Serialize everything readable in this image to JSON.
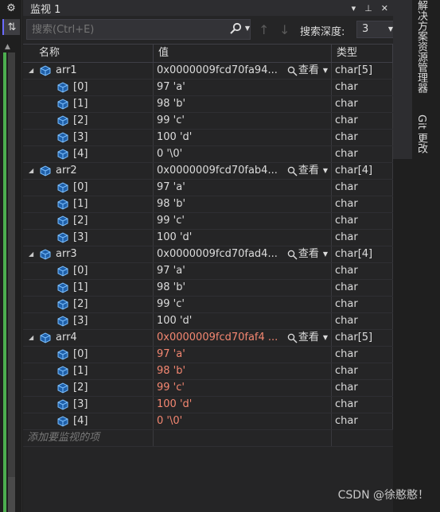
{
  "toolbar_left": {
    "gear_glyph": "⚙",
    "pin_glyph": "⇅"
  },
  "window": {
    "title": "监视 1",
    "dropdown_glyph": "▾",
    "pin_glyph": "⊥",
    "close_glyph": "✕"
  },
  "search": {
    "placeholder": "搜索(Ctrl+E)",
    "depth_label": "搜索深度:",
    "depth_value": "3"
  },
  "columns": {
    "name": "名称",
    "value": "值",
    "type": "类型"
  },
  "view_label": "查看",
  "rows": [
    {
      "level": 0,
      "name": "arr1",
      "value": "0x0000009fcd70fa94...",
      "type": "char[5]",
      "has_view": true,
      "changed": false
    },
    {
      "level": 1,
      "name": "[0]",
      "value": "97 'a'",
      "type": "char",
      "changed": false
    },
    {
      "level": 1,
      "name": "[1]",
      "value": "98 'b'",
      "type": "char",
      "changed": false
    },
    {
      "level": 1,
      "name": "[2]",
      "value": "99 'c'",
      "type": "char",
      "changed": false
    },
    {
      "level": 1,
      "name": "[3]",
      "value": "100 'd'",
      "type": "char",
      "changed": false
    },
    {
      "level": 1,
      "name": "[4]",
      "value": "0 '\\0'",
      "type": "char",
      "changed": false
    },
    {
      "level": 0,
      "name": "arr2",
      "value": "0x0000009fcd70fab4...",
      "type": "char[4]",
      "has_view": true,
      "changed": false
    },
    {
      "level": 1,
      "name": "[0]",
      "value": "97 'a'",
      "type": "char",
      "changed": false
    },
    {
      "level": 1,
      "name": "[1]",
      "value": "98 'b'",
      "type": "char",
      "changed": false
    },
    {
      "level": 1,
      "name": "[2]",
      "value": "99 'c'",
      "type": "char",
      "changed": false
    },
    {
      "level": 1,
      "name": "[3]",
      "value": "100 'd'",
      "type": "char",
      "changed": false
    },
    {
      "level": 0,
      "name": "arr3",
      "value": "0x0000009fcd70fad4...",
      "type": "char[4]",
      "has_view": true,
      "changed": false
    },
    {
      "level": 1,
      "name": "[0]",
      "value": "97 'a'",
      "type": "char",
      "changed": false
    },
    {
      "level": 1,
      "name": "[1]",
      "value": "98 'b'",
      "type": "char",
      "changed": false
    },
    {
      "level": 1,
      "name": "[2]",
      "value": "99 'c'",
      "type": "char",
      "changed": false
    },
    {
      "level": 1,
      "name": "[3]",
      "value": "100 'd'",
      "type": "char",
      "changed": false
    },
    {
      "level": 0,
      "name": "arr4",
      "value": "0x0000009fcd70faf4 ...",
      "type": "char[5]",
      "has_view": true,
      "changed": true
    },
    {
      "level": 1,
      "name": "[0]",
      "value": "97 'a'",
      "type": "char",
      "changed": true
    },
    {
      "level": 1,
      "name": "[1]",
      "value": "98 'b'",
      "type": "char",
      "changed": true
    },
    {
      "level": 1,
      "name": "[2]",
      "value": "99 'c'",
      "type": "char",
      "changed": true
    },
    {
      "level": 1,
      "name": "[3]",
      "value": "100 'd'",
      "type": "char",
      "changed": true
    },
    {
      "level": 1,
      "name": "[4]",
      "value": "0 '\\0'",
      "type": "char",
      "changed": true
    }
  ],
  "add_watch_placeholder": "添加要监视的项",
  "side_tabs": {
    "solution_explorer": "解决方案资源管理器",
    "git_changes": "Git 更改"
  },
  "watermark": "CSDN @徐憨憨！",
  "colors": {
    "background": "#252526",
    "changed_value": "#f48771",
    "accent_green": "#4cae4f",
    "icon_blue": "#4b9fe0"
  }
}
